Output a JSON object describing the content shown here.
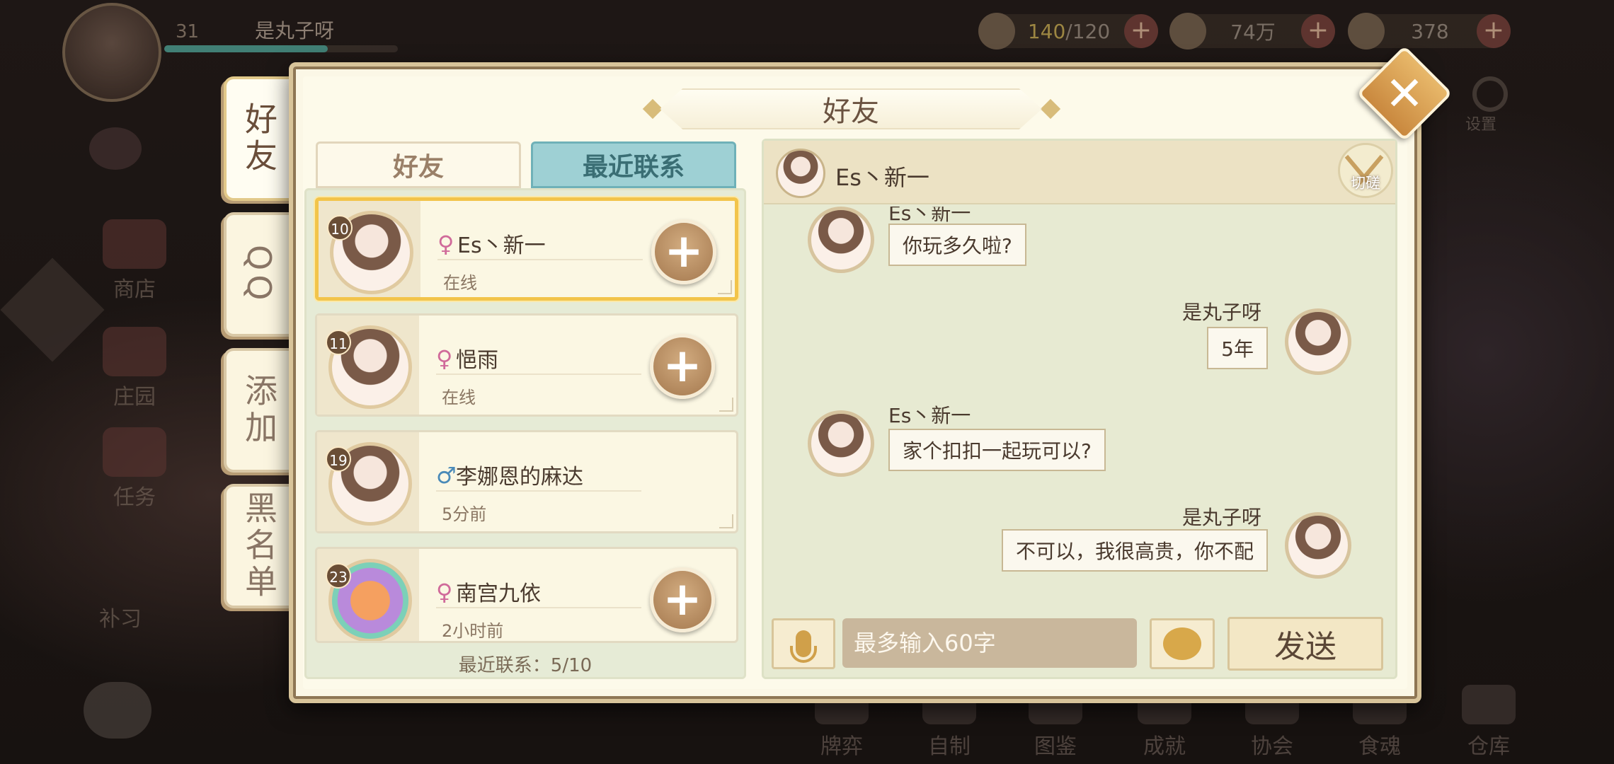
{
  "player": {
    "level": "31",
    "name": "是丸子呀"
  },
  "resources": {
    "stamina": {
      "current": "140",
      "max": "/120"
    },
    "coins": "74万",
    "gems": "378"
  },
  "top_right": {
    "settings_label": "设置"
  },
  "left_menu": [
    "商店",
    "庄园",
    "任务",
    "补习"
  ],
  "bottom_menu": [
    "牌弈",
    "自制",
    "图鉴",
    "成就",
    "协会",
    "食魂",
    "仓库"
  ],
  "dialog": {
    "title": "好友",
    "side_tabs": [
      "好友",
      "QQ",
      "添加",
      "黑名单"
    ],
    "list_tabs": {
      "friends": "好友",
      "recent": "最近联系"
    },
    "contacts": [
      {
        "level": "10",
        "gender": "♀",
        "name": "Es丶新一",
        "status": "在线"
      },
      {
        "level": "11",
        "gender": "♀",
        "name": "悒雨",
        "status": "在线"
      },
      {
        "level": "19",
        "gender": "♂",
        "name": "李娜恩的麻达",
        "status": "5分前"
      },
      {
        "level": "23",
        "gender": "♀",
        "name": "南宫九依",
        "status": "2小时前"
      }
    ],
    "recent_count": "最近联系：5/10"
  },
  "chat": {
    "partner_name": "Es丶新一",
    "poke_label": "切磋",
    "messages": [
      {
        "from": "Es丶新一",
        "text": "你玩多久啦?"
      },
      {
        "from": "是丸子呀",
        "text": "5年"
      },
      {
        "from": "Es丶新一",
        "text": "家个扣扣一起玩可以?"
      },
      {
        "from": "是丸子呀",
        "text": "不可以，我很高贵，你不配"
      }
    ],
    "input_placeholder": "最多输入60字",
    "send_label": "发送"
  },
  "colors": {
    "accent": "#f2c44a",
    "tab_active": "#9ed0d4",
    "female": "#d06a9a",
    "male": "#4a8ab8"
  }
}
